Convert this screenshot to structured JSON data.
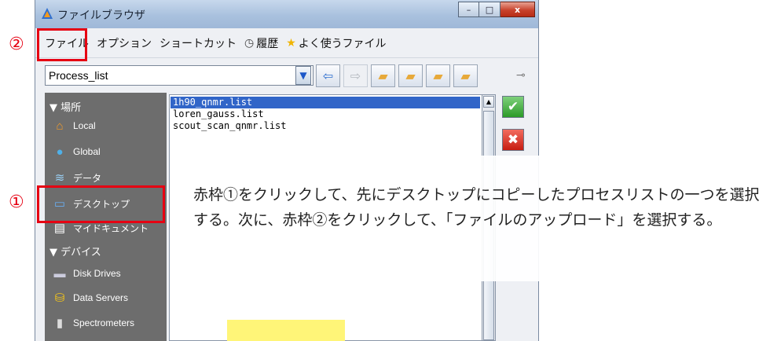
{
  "window": {
    "title": "ファイルブラウザ",
    "caption_buttons": {
      "minimize": "–",
      "maximize": "□",
      "close": "x"
    }
  },
  "menu": [
    {
      "label": "ファイル",
      "icon": ""
    },
    {
      "label": "オプション",
      "icon": ""
    },
    {
      "label": "ショートカット",
      "icon": ""
    },
    {
      "label": "履歴",
      "icon": "clock-icon"
    },
    {
      "label": "よく使うファイル",
      "icon": "star-icon"
    }
  ],
  "toolbar": {
    "path_value": "Process_list",
    "buttons": [
      "back-arrow-icon",
      "forward-arrow-icon",
      "folder-up-icon",
      "folder-new-icon",
      "folder-favorite-icon",
      "folder-refresh-icon"
    ]
  },
  "sidebar": {
    "places_header": "▼ 場所",
    "places": [
      {
        "label": "Local",
        "icon": "home-icon"
      },
      {
        "label": "Global",
        "icon": "globe-icon"
      },
      {
        "label": "データ",
        "icon": "data-icon"
      },
      {
        "label": "デスクトップ",
        "icon": "desktop-icon"
      },
      {
        "label": "マイドキュメント",
        "icon": "document-icon"
      }
    ],
    "devices_header": "▼ デバイス",
    "devices": [
      {
        "label": "Disk Drives",
        "icon": "disk-drive-icon"
      },
      {
        "label": "Data Servers",
        "icon": "database-icon"
      },
      {
        "label": "Spectrometers",
        "icon": "spectrometer-icon"
      }
    ]
  },
  "files": [
    {
      "name": "1h90_qnmr.list",
      "selected": true
    },
    {
      "name": "loren_gauss.list",
      "selected": false
    },
    {
      "name": "scout_scan_qnmr.list",
      "selected": false
    }
  ],
  "annotations": {
    "marker_1": "①",
    "marker_2": "②",
    "instruction": "赤枠①をクリックして、先にデスクトップにコピーしたプロセスリストの一つを選択する。次に、赤枠②をクリックして、「ファイルのアップロード」を選択する。",
    "colors": {
      "red": "#e60012",
      "highlight": "#fff578"
    }
  }
}
